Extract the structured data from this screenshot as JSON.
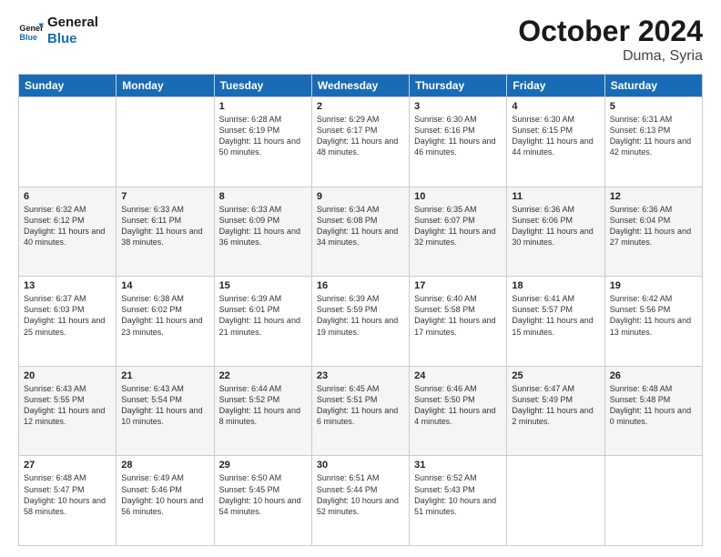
{
  "header": {
    "logo_line1": "General",
    "logo_line2": "Blue",
    "month_title": "October 2024",
    "location": "Duma, Syria"
  },
  "days_of_week": [
    "Sunday",
    "Monday",
    "Tuesday",
    "Wednesday",
    "Thursday",
    "Friday",
    "Saturday"
  ],
  "weeks": [
    [
      {
        "day": "",
        "content": ""
      },
      {
        "day": "",
        "content": ""
      },
      {
        "day": "1",
        "content": "Sunrise: 6:28 AM\nSunset: 6:19 PM\nDaylight: 11 hours and 50 minutes."
      },
      {
        "day": "2",
        "content": "Sunrise: 6:29 AM\nSunset: 6:17 PM\nDaylight: 11 hours and 48 minutes."
      },
      {
        "day": "3",
        "content": "Sunrise: 6:30 AM\nSunset: 6:16 PM\nDaylight: 11 hours and 46 minutes."
      },
      {
        "day": "4",
        "content": "Sunrise: 6:30 AM\nSunset: 6:15 PM\nDaylight: 11 hours and 44 minutes."
      },
      {
        "day": "5",
        "content": "Sunrise: 6:31 AM\nSunset: 6:13 PM\nDaylight: 11 hours and 42 minutes."
      }
    ],
    [
      {
        "day": "6",
        "content": "Sunrise: 6:32 AM\nSunset: 6:12 PM\nDaylight: 11 hours and 40 minutes."
      },
      {
        "day": "7",
        "content": "Sunrise: 6:33 AM\nSunset: 6:11 PM\nDaylight: 11 hours and 38 minutes."
      },
      {
        "day": "8",
        "content": "Sunrise: 6:33 AM\nSunset: 6:09 PM\nDaylight: 11 hours and 36 minutes."
      },
      {
        "day": "9",
        "content": "Sunrise: 6:34 AM\nSunset: 6:08 PM\nDaylight: 11 hours and 34 minutes."
      },
      {
        "day": "10",
        "content": "Sunrise: 6:35 AM\nSunset: 6:07 PM\nDaylight: 11 hours and 32 minutes."
      },
      {
        "day": "11",
        "content": "Sunrise: 6:36 AM\nSunset: 6:06 PM\nDaylight: 11 hours and 30 minutes."
      },
      {
        "day": "12",
        "content": "Sunrise: 6:36 AM\nSunset: 6:04 PM\nDaylight: 11 hours and 27 minutes."
      }
    ],
    [
      {
        "day": "13",
        "content": "Sunrise: 6:37 AM\nSunset: 6:03 PM\nDaylight: 11 hours and 25 minutes."
      },
      {
        "day": "14",
        "content": "Sunrise: 6:38 AM\nSunset: 6:02 PM\nDaylight: 11 hours and 23 minutes."
      },
      {
        "day": "15",
        "content": "Sunrise: 6:39 AM\nSunset: 6:01 PM\nDaylight: 11 hours and 21 minutes."
      },
      {
        "day": "16",
        "content": "Sunrise: 6:39 AM\nSunset: 5:59 PM\nDaylight: 11 hours and 19 minutes."
      },
      {
        "day": "17",
        "content": "Sunrise: 6:40 AM\nSunset: 5:58 PM\nDaylight: 11 hours and 17 minutes."
      },
      {
        "day": "18",
        "content": "Sunrise: 6:41 AM\nSunset: 5:57 PM\nDaylight: 11 hours and 15 minutes."
      },
      {
        "day": "19",
        "content": "Sunrise: 6:42 AM\nSunset: 5:56 PM\nDaylight: 11 hours and 13 minutes."
      }
    ],
    [
      {
        "day": "20",
        "content": "Sunrise: 6:43 AM\nSunset: 5:55 PM\nDaylight: 11 hours and 12 minutes."
      },
      {
        "day": "21",
        "content": "Sunrise: 6:43 AM\nSunset: 5:54 PM\nDaylight: 11 hours and 10 minutes."
      },
      {
        "day": "22",
        "content": "Sunrise: 6:44 AM\nSunset: 5:52 PM\nDaylight: 11 hours and 8 minutes."
      },
      {
        "day": "23",
        "content": "Sunrise: 6:45 AM\nSunset: 5:51 PM\nDaylight: 11 hours and 6 minutes."
      },
      {
        "day": "24",
        "content": "Sunrise: 6:46 AM\nSunset: 5:50 PM\nDaylight: 11 hours and 4 minutes."
      },
      {
        "day": "25",
        "content": "Sunrise: 6:47 AM\nSunset: 5:49 PM\nDaylight: 11 hours and 2 minutes."
      },
      {
        "day": "26",
        "content": "Sunrise: 6:48 AM\nSunset: 5:48 PM\nDaylight: 11 hours and 0 minutes."
      }
    ],
    [
      {
        "day": "27",
        "content": "Sunrise: 6:48 AM\nSunset: 5:47 PM\nDaylight: 10 hours and 58 minutes."
      },
      {
        "day": "28",
        "content": "Sunrise: 6:49 AM\nSunset: 5:46 PM\nDaylight: 10 hours and 56 minutes."
      },
      {
        "day": "29",
        "content": "Sunrise: 6:50 AM\nSunset: 5:45 PM\nDaylight: 10 hours and 54 minutes."
      },
      {
        "day": "30",
        "content": "Sunrise: 6:51 AM\nSunset: 5:44 PM\nDaylight: 10 hours and 52 minutes."
      },
      {
        "day": "31",
        "content": "Sunrise: 6:52 AM\nSunset: 5:43 PM\nDaylight: 10 hours and 51 minutes."
      },
      {
        "day": "",
        "content": ""
      },
      {
        "day": "",
        "content": ""
      }
    ]
  ]
}
